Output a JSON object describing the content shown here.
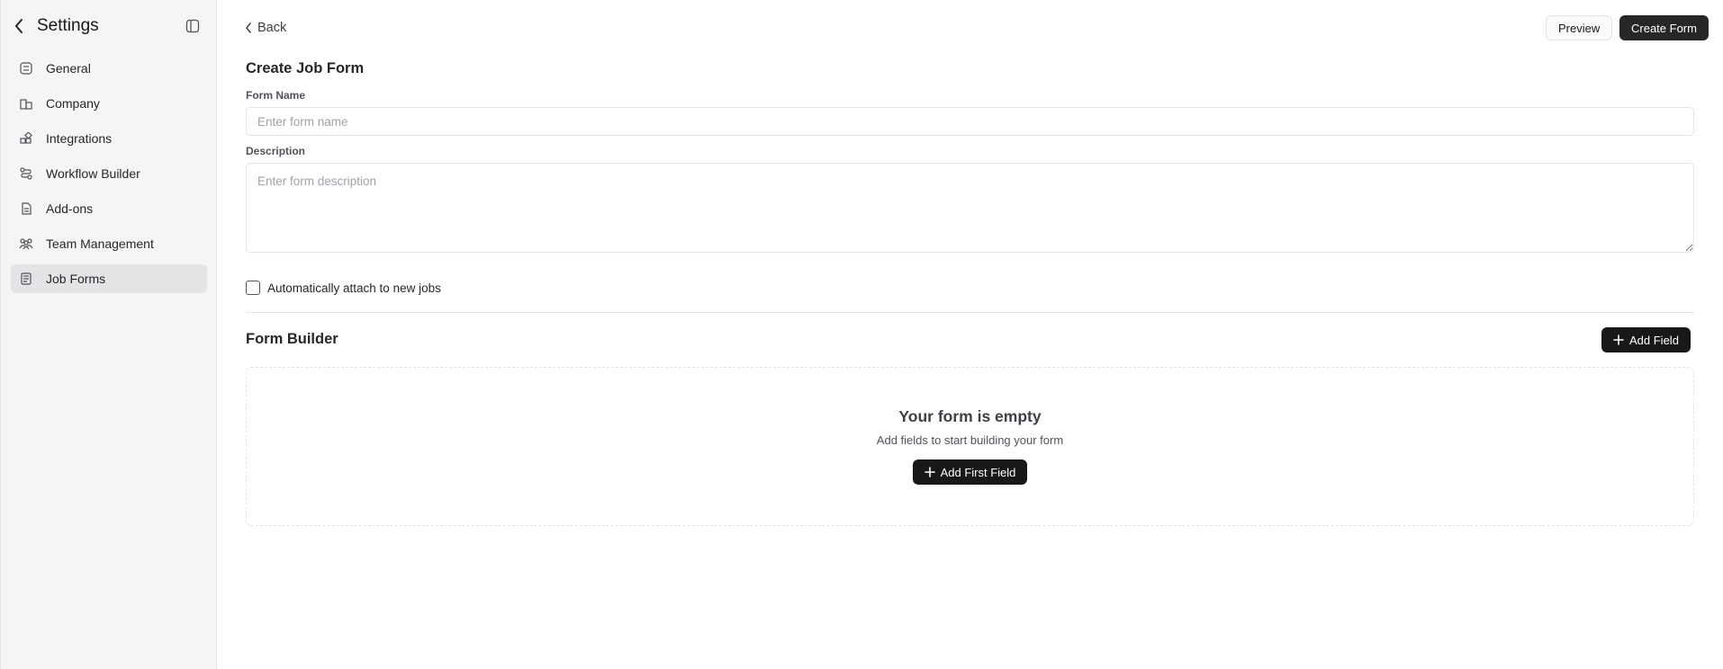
{
  "sidebar": {
    "title": "Settings",
    "items": [
      {
        "label": "General",
        "icon": "general-icon",
        "active": false
      },
      {
        "label": "Company",
        "icon": "building-icon",
        "active": false
      },
      {
        "label": "Integrations",
        "icon": "integrations-icon",
        "active": false
      },
      {
        "label": "Workflow Builder",
        "icon": "workflow-icon",
        "active": false
      },
      {
        "label": "Add-ons",
        "icon": "document-icon",
        "active": false
      },
      {
        "label": "Team Management",
        "icon": "team-icon",
        "active": false
      },
      {
        "label": "Job Forms",
        "icon": "form-icon",
        "active": true
      }
    ]
  },
  "header": {
    "back_label": "Back",
    "preview_label": "Preview",
    "create_label": "Create Form"
  },
  "form": {
    "title": "Create Job Form",
    "name_label": "Form Name",
    "name_placeholder": "Enter form name",
    "name_value": "",
    "description_label": "Description",
    "description_placeholder": "Enter form description",
    "description_value": "",
    "auto_attach_label": "Automatically attach to new jobs",
    "auto_attach_checked": false
  },
  "builder": {
    "title": "Form Builder",
    "add_field_label": "Add Field",
    "empty_title": "Your form is empty",
    "empty_subtitle": "Add fields to start building your form",
    "add_first_label": "Add First Field"
  },
  "colors": {
    "accent_dark": "#18181b",
    "sidebar_bg": "#f5f5f5",
    "active_item_bg": "#e4e4e7",
    "border": "#e4e4e7"
  }
}
